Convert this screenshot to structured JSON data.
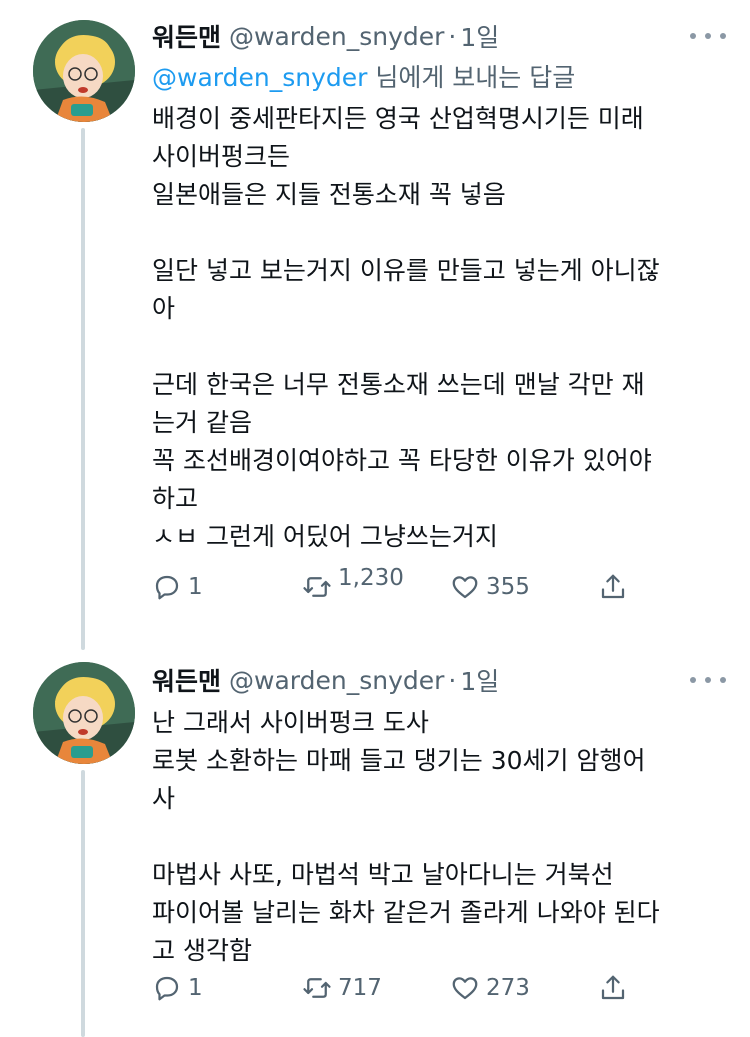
{
  "colors": {
    "text": "#0f1419",
    "secondary": "#536471",
    "link": "#1d9bf0",
    "thread_line": "#cfd9de"
  },
  "tweets": [
    {
      "author_name": "워든맨",
      "handle": "@warden_snyder",
      "separator": "·",
      "time": "1일",
      "replying_mention": "@warden_snyder",
      "replying_suffix": " 님에게 보내는 답글",
      "text": "배경이 중세판타지든 영국 산업혁명시기든 미래\n사이버펑크든\n일본애들은 지들 전통소재 꼭 넣음\n\n일단 넣고 보는거지 이유를 만들고 넣는게 아니잖\n아\n\n근데 한국은 너무 전통소재 쓰는데 맨날 각만 재\n는거 같음\n꼭 조선배경이여야하고 꼭 타당한 이유가 있어야\n하고\nㅅㅂ 그런게 어딨어 그냥쓰는거지",
      "replies": "1",
      "retweets": "1,230",
      "likes": "355",
      "icons": {
        "reply": "reply-icon",
        "retweet": "retweet-icon",
        "like": "heart-icon",
        "share": "share-icon",
        "more": "more-icon"
      }
    },
    {
      "author_name": "워든맨",
      "handle": "@warden_snyder",
      "separator": "·",
      "time": "1일",
      "text": "난 그래서 사이버펑크 도사\n로봇 소환하는 마패 들고 댕기는 30세기 암행어\n사\n\n마법사 사또, 마법석 박고 날아다니는 거북선\n파이어볼 날리는 화차 같은거 졸라게 나와야 된다\n고 생각함",
      "replies": "1",
      "retweets": "717",
      "likes": "273",
      "icons": {
        "reply": "reply-icon",
        "retweet": "retweet-icon",
        "like": "heart-icon",
        "share": "share-icon",
        "more": "more-icon"
      }
    }
  ]
}
